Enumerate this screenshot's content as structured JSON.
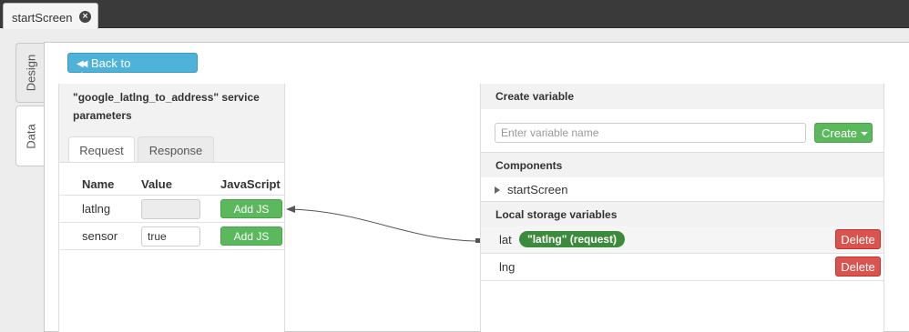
{
  "top_tab": {
    "label": "startScreen",
    "close_glyph": "×"
  },
  "side_tabs": {
    "design": "Design",
    "data": "Data"
  },
  "back_button": {
    "icon": "double-chevron-left-icon",
    "glyph": "◀◀",
    "label": "Back to datasources"
  },
  "service": {
    "title": "\"google_latlng_to_address\" service parameters",
    "tabs": [
      "Request",
      "Response"
    ],
    "columns": [
      "Name",
      "Value",
      "JavaScript"
    ],
    "params": [
      {
        "name": "latlng",
        "value": "",
        "js_label": "Add JS"
      },
      {
        "name": "sensor",
        "value": "true",
        "js_label": "Add JS"
      }
    ]
  },
  "create_variable": {
    "header": "Create variable",
    "placeholder": "Enter variable name",
    "button_label": "Create"
  },
  "components": {
    "header": "Components",
    "items": [
      "startScreen"
    ]
  },
  "local_storage": {
    "header": "Local storage variables",
    "items": [
      {
        "name": "lat",
        "binding": "\"latlng\" (request)",
        "delete_label": "Delete"
      },
      {
        "name": "lng",
        "binding": "",
        "delete_label": "Delete"
      }
    ]
  },
  "colors": {
    "topbar": "#3a3a3a",
    "info_button": "#4fb3d9",
    "success": "#5cb85c",
    "badge": "#3c8a3c",
    "danger": "#d9534f"
  }
}
